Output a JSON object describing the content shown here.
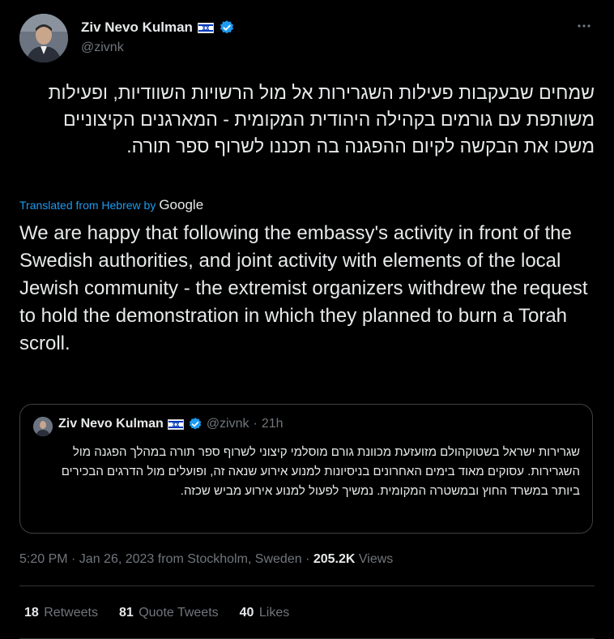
{
  "author": {
    "name": "Ziv Nevo Kulman",
    "handle": "@zivnk"
  },
  "tweet": {
    "hebrew_text": "שמחים שבעקבות פעילות השגרירות אל מול הרשויות השוודיות, ופעילות משותפת עם גורמים בקהילה היהודית המקומית - המארגנים הקיצוניים משכו את הבקשה לקיום ההפגנה בה תכננו לשרוף ספר תורה.",
    "translated_label": "Translated from Hebrew by",
    "translator": "Google",
    "english_text": "We are happy that following the embassy's activity in front of the Swedish authorities, and joint activity with elements of the local Jewish community - the extremist organizers withdrew the request to hold the demonstration in which they planned to burn a Torah scroll."
  },
  "quoted_tweet": {
    "name": "Ziv Nevo Kulman",
    "handle": "@zivnk",
    "separator": "·",
    "time": "21h",
    "text": "שגרירות ישראל בשטוקהולם מזועזעת מכוונת גורם מוסלמי קיצוני לשרוף ספר תורה במהלך הפגנה מול השגרירות. עסוקים מאוד בימים האחרונים בניסיונות למנוע אירוע שנאה זה, ופועלים מול הדרגים הבכירים ביותר במשרד החוץ ובמשטרה המקומית. נמשיך לפעול למנוע אירוע מביש שכזה."
  },
  "meta": {
    "timestamp": "5:20 PM · Jan 26, 2023 from Stockholm, Sweden",
    "separator": " · ",
    "views_count": "205.2K",
    "views_label": " Views"
  },
  "stats": {
    "retweets_count": "18",
    "retweets_label": "Retweets",
    "quotes_count": "81",
    "quotes_label": "Quote Tweets",
    "likes_count": "40",
    "likes_label": "Likes"
  },
  "colors": {
    "accent": "#1d9bf0",
    "background": "#000000",
    "text": "#e7e9ea",
    "muted": "#71767b"
  }
}
